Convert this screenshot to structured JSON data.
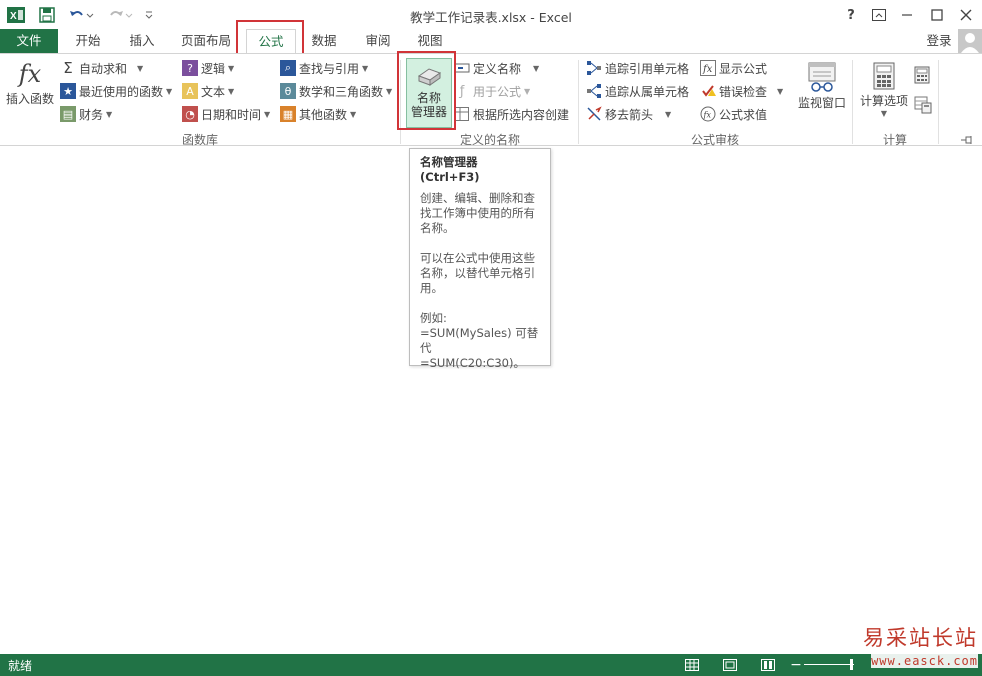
{
  "window": {
    "title": "教学工作记录表.xlsx - Excel",
    "help": "?",
    "signin": "登录"
  },
  "tabs": [
    {
      "label": "文件"
    },
    {
      "label": "开始"
    },
    {
      "label": "插入"
    },
    {
      "label": "页面布局"
    },
    {
      "label": "公式"
    },
    {
      "label": "数据"
    },
    {
      "label": "审阅"
    },
    {
      "label": "视图"
    }
  ],
  "ribbon": {
    "function_library": {
      "label": "函数库",
      "insert_function": "插入函数",
      "fx_symbol": "fx",
      "autosum": "自动求和",
      "recent": "最近使用的函数",
      "financial": "财务",
      "logical": "逻辑",
      "text": "文本",
      "datetime": "日期和时间",
      "lookup": "查找与引用",
      "math": "数学和三角函数",
      "more": "其他函数"
    },
    "defined_names": {
      "label": "定义的名称",
      "name_manager_line1": "名称",
      "name_manager_line2": "管理器",
      "define_name": "定义名称",
      "use_in_formula": "用于公式",
      "create_from_selection": "根据所选内容创建"
    },
    "formula_auditing": {
      "label": "公式审核",
      "trace_precedents": "追踪引用单元格",
      "trace_dependents": "追踪从属单元格",
      "remove_arrows": "移去箭头",
      "show_formulas": "显示公式",
      "error_checking": "错误检查",
      "evaluate_formula": "公式求值",
      "watch_window": "监视窗口"
    },
    "calculation": {
      "label": "计算",
      "calc_options": "计算选项"
    }
  },
  "tooltip": {
    "title": "名称管理器 (Ctrl+F3)",
    "para1": "创建、编辑、删除和查找工作簿中使用的所有名称。",
    "para2": "可以在公式中使用这些名称，以替代单元格引用。",
    "example_label": "例如:",
    "example_line1": "=SUM(MySales) 可替代",
    "example_line2": "=SUM(C20:C30)。"
  },
  "statusbar": {
    "status": "就绪"
  },
  "watermark": {
    "cn": "易采站长站",
    "url": "www.easck.com"
  },
  "colors": {
    "excel_green": "#217346",
    "highlight_red": "#d13438"
  }
}
